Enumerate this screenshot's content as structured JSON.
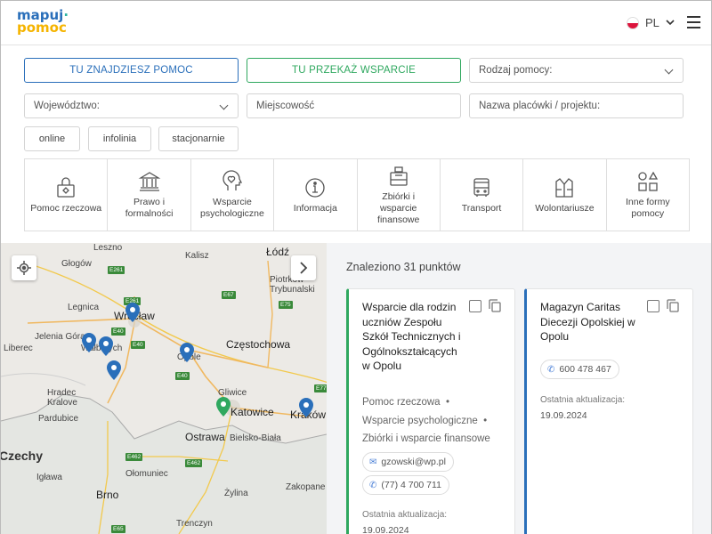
{
  "logo": {
    "line1": "mapuj",
    "line2": "pomoc"
  },
  "header": {
    "language": "PL"
  },
  "filters": {
    "help_button": "TU ZNAJDZIESZ POMOC",
    "support_button": "TU PRZEKAŻ WSPARCIE",
    "help_type_placeholder": "Rodzaj pomocy:",
    "voivodeship_placeholder": "Województwo:",
    "city_placeholder": "Miejscowość",
    "name_placeholder": "Nazwa placówki / projektu:",
    "chips": [
      "online",
      "infolinia",
      "stacjonarnie"
    ]
  },
  "categories": [
    {
      "label": "Pomoc rzeczowa",
      "icon": "gift-bag-icon"
    },
    {
      "label": "Prawo i\nformalności",
      "icon": "courthouse-icon"
    },
    {
      "label": "Wsparcie\npsychologiczne",
      "icon": "head-heart-icon"
    },
    {
      "label": "Informacja",
      "icon": "info-icon"
    },
    {
      "label": "Zbiórki i\nwsparcie\nfinansowe",
      "icon": "donation-box-icon"
    },
    {
      "label": "Transport",
      "icon": "bus-icon"
    },
    {
      "label": "Wolontariusze",
      "icon": "vest-icon"
    },
    {
      "label": "Inne formy\npomocy",
      "icon": "shapes-icon"
    }
  ],
  "map": {
    "labels": {
      "leszno": "Leszno",
      "lodz": "Łódź",
      "kalisz": "Kalisz",
      "glogow": "Głogów",
      "piotrkow": "Piotrków\nTrybunalski",
      "legnica": "Legnica",
      "wroclaw": "Wrocław",
      "jelenia": "Jelenia Góra",
      "walbrzych": "Wałbrzych",
      "liberec": "Liberec",
      "opole": "Opole",
      "czestochowa": "Częstochowa",
      "hradec": "Hradec\nKralove",
      "pardubice": "Pardubice",
      "gliwice": "Gliwice",
      "katowice": "Katowice",
      "krakow": "Kraków",
      "ostrawa": "Ostrawa",
      "bielsko": "Bielsko-Biała",
      "czechy": "Czechy",
      "olomouniec": "Ołomuniec",
      "iglawa": "Igława",
      "zylina": "Żylina",
      "zakopane": "Zakopane",
      "brno": "Brno",
      "trenczyn": "Trenczyn"
    },
    "roads": {
      "e261a": "E261",
      "e67": "E67",
      "e261b": "E261",
      "e75": "E75",
      "e40a": "E40",
      "e40b": "E40",
      "e40c": "E40",
      "e462a": "E462",
      "e462b": "E462",
      "e77": "E77",
      "e65": "E65"
    },
    "colors": {
      "pin_blue": "#2a6fba",
      "pin_green": "#2fa85f",
      "road_green": "#3a8a3a"
    }
  },
  "results": {
    "count_text": "Znaleziono 31 punktów",
    "cards": [
      {
        "title": "Wsparcie dla rodzin uczniów Zespołu Szkół Technicznych i Ogólnokształcących w Opolu",
        "tags": [
          "Pomoc rzeczowa",
          "Wsparcie psychologiczne",
          "Zbiórki i wsparcie finansowe"
        ],
        "email": "gzowski@wp.pl",
        "phone": "(77) 4 700 711",
        "updated_label": "Ostatnia aktualizacja:",
        "updated_value": "19.09.2024",
        "accent": "#2fa85f"
      },
      {
        "title": "Magazyn Caritas Diecezji Opolskiej w Opolu",
        "phone": "600 478 467",
        "updated_label": "Ostatnia aktualizacja:",
        "updated_value": "19.09.2024",
        "accent": "#2a6fba"
      }
    ]
  }
}
